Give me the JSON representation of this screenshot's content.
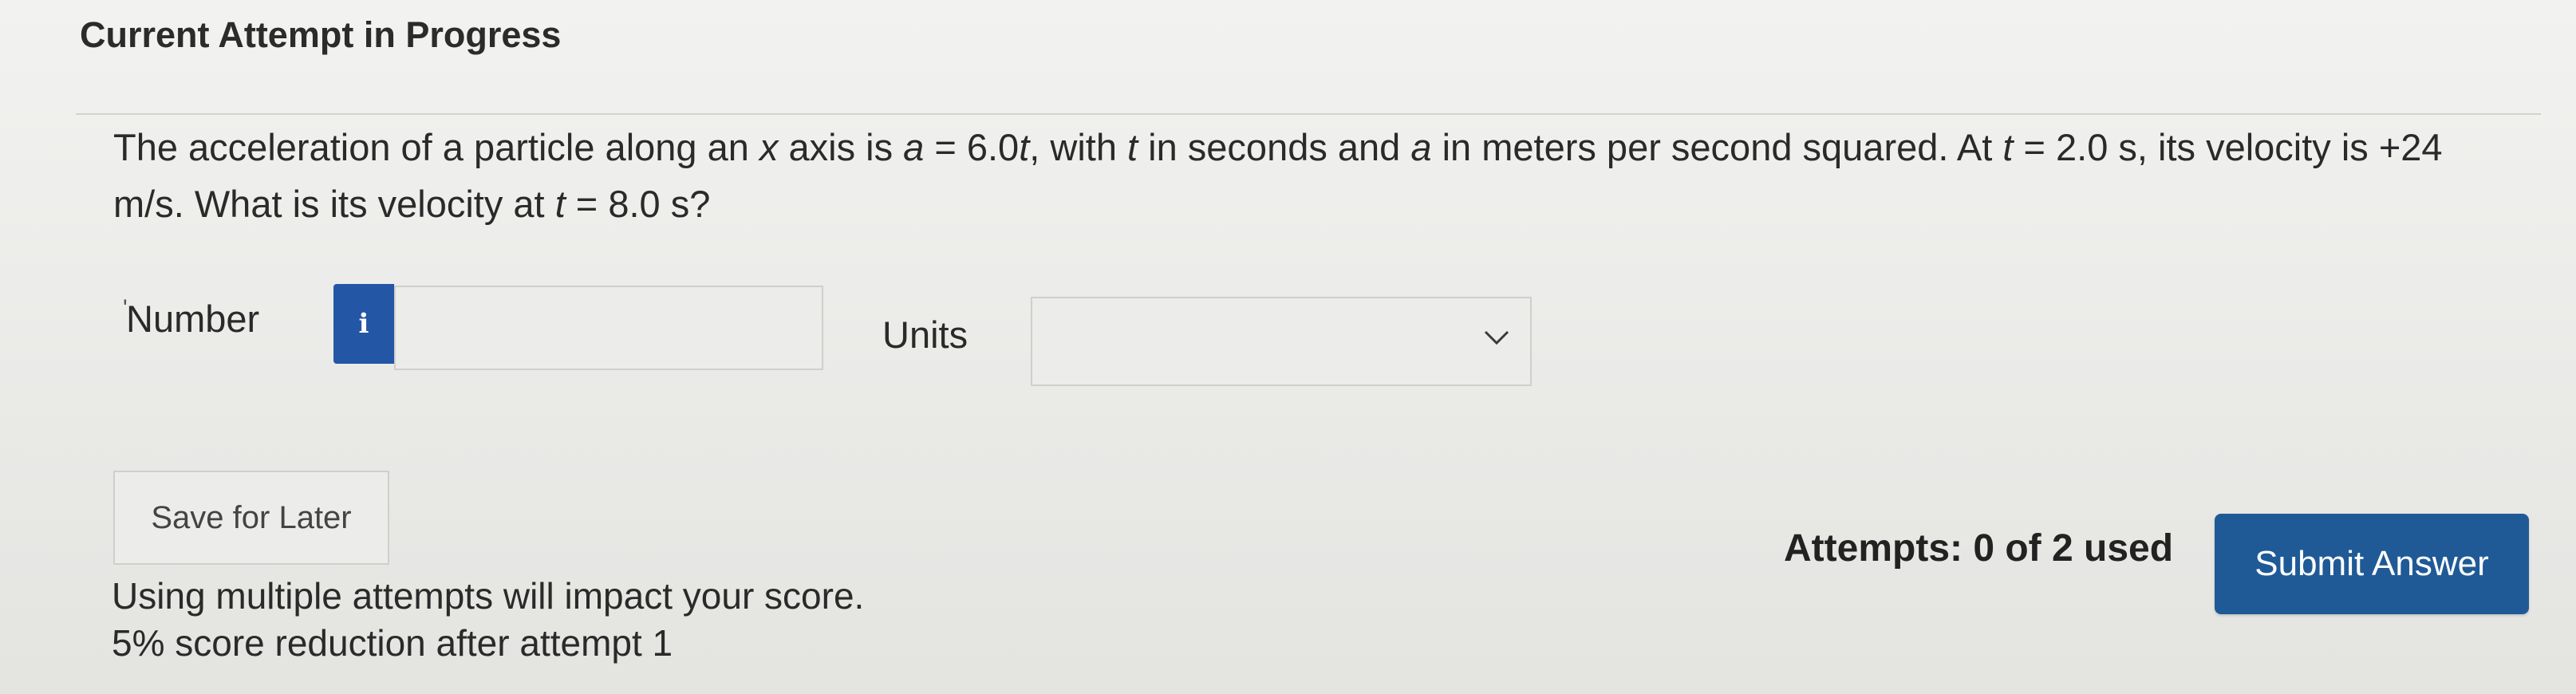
{
  "header": {
    "title": "Current Attempt in Progress"
  },
  "question": {
    "p1": "The acceleration of a particle along an ",
    "var_x": "x",
    "p2": " axis is ",
    "var_a1": "a",
    "p3": " = 6.0",
    "var_t1": "t",
    "p4": ", with ",
    "var_t2": "t",
    "p5": " in seconds and ",
    "var_a2": "a",
    "p6": " in meters per second squared. At ",
    "var_t3": "t",
    "p7": " = 2.0 s, its velocity is +24 m/s. What is its velocity at ",
    "var_t4": "t",
    "p8": " = 8.0 s?"
  },
  "answer": {
    "required_mark": "'",
    "number_label": "Number",
    "info_icon_glyph": "i",
    "number_value": "",
    "units_label": "Units",
    "units_selected": ""
  },
  "actions": {
    "save_label": "Save for Later",
    "submit_label": "Submit Answer",
    "attempts_text": "Attempts: 0 of 2 used"
  },
  "warning": {
    "line1": "Using multiple attempts will impact your score.",
    "line2": "5% score reduction after attempt 1"
  },
  "colors": {
    "submit_bg": "#1f5a96",
    "info_bg": "#2456a6",
    "page_bg": "#ebebe8"
  },
  "icons": {
    "info": "info-icon",
    "units_dropdown": "chevron-down-icon"
  }
}
